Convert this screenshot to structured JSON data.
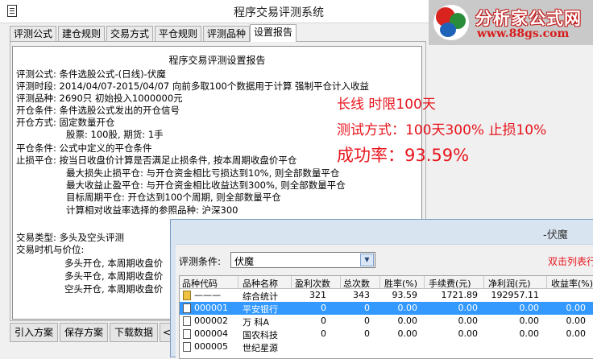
{
  "window": {
    "title": "程序交易评测系统"
  },
  "logo": {
    "brand": "分析家公式网",
    "url": "www.88gs.com"
  },
  "tabs": [
    {
      "label": "评测公式"
    },
    {
      "label": "建仓规则"
    },
    {
      "label": "交易方式"
    },
    {
      "label": "平仓规则"
    },
    {
      "label": "评测品种"
    },
    {
      "label": "设置报告",
      "active": true
    }
  ],
  "report": {
    "heading": "程序交易评测设置报告",
    "lines": [
      "评测公式: 条件选股公式-(日线)-伏魔",
      "评测时段: 2014/04/07-2015/04/07 向前多取100个数据用于计算 强制平仓计入收益",
      "评测品种: 2690只 初始投入1000000元",
      "开仓条件: 条件选股公式发出的开仓信号",
      "开仓方式: 固定数量开仓",
      "股票: 100股, 期货: 1手",
      "平仓条件: 公式中定义的平仓条件",
      "止损平仓: 按当日收盘价计算是否满足止损条件, 按本周期收盘价平仓",
      "最大损失止损平仓: 与开仓资金相比亏损达到10%, 则全部数量平仓",
      "最大收益止盈平仓: 与开仓资金相比收益达到300%, 则全部数量平仓",
      "目标周期平仓: 开仓达到100个周期, 则全部数量平仓",
      "计算相对收益率选择的参照品种: 沪深300",
      "交易类型: 多头及空头评测",
      "交易时机与价位:",
      "多头开仓, 本周期收盘价",
      "多头平仓, 本周期收盘价",
      "空头开仓, 本周期收盘价"
    ]
  },
  "overlay": {
    "line1": "长线  时限100天",
    "line2": "测试方式：100天300%  止损10%",
    "line3": "成功率：93.59%"
  },
  "buttons": {
    "import": "引入方案",
    "save": "保存方案",
    "download": "下载数据",
    "more": "<"
  },
  "stats_window": {
    "title": "-伏魔",
    "condition_label": "评测条件:",
    "condition_value": "伏魔",
    "hint": "双击列表行",
    "columns": [
      "品种代码",
      "品种名称",
      "盈利次数",
      "总次数",
      "胜率(%)",
      "手续费(元)",
      "净利润(元)",
      "收益率(%)"
    ],
    "rows": [
      {
        "code": "———",
        "name": "综合统计",
        "wins": "321",
        "total": "343",
        "rate": "93.59",
        "fee": "1721.89",
        "profit": "192957.11",
        "ret": "",
        "icon": "summary"
      },
      {
        "code": "000001",
        "name": "平安银行",
        "wins": "0",
        "total": "0",
        "rate": "0.00",
        "fee": "0.00",
        "profit": "0.00",
        "ret": "0.00",
        "selected": true
      },
      {
        "code": "000002",
        "name": "万  科A",
        "wins": "0",
        "total": "0",
        "rate": "0.00",
        "fee": "0.00",
        "profit": "0.00",
        "ret": "0.00"
      },
      {
        "code": "000004",
        "name": "国农科技",
        "wins": "0",
        "total": "0",
        "rate": "0.00",
        "fee": "0.00",
        "profit": "0.00",
        "ret": "0.00"
      },
      {
        "code": "000005",
        "name": "世纪星源",
        "wins": "",
        "total": "",
        "rate": "",
        "fee": "",
        "profit": "",
        "ret": ""
      }
    ]
  },
  "colors": {
    "accent_red": "#e8141c",
    "selection": "#3399ff",
    "window_frame": "#d9e4f1"
  }
}
